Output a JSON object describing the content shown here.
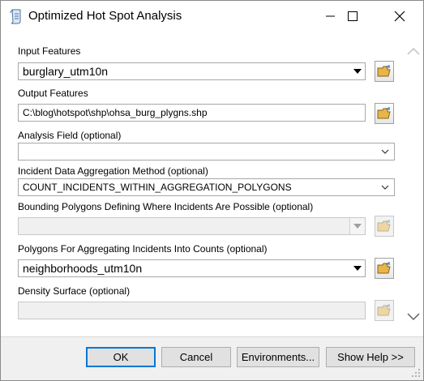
{
  "window": {
    "title": "Optimized Hot Spot Analysis",
    "controls": {
      "minimize_icon": "minimize-icon",
      "maximize_icon": "maximize-icon",
      "close_icon": "close-icon"
    }
  },
  "form": {
    "input_features": {
      "label": "Input Features",
      "value": "burglary_utm10n"
    },
    "output_features": {
      "label": "Output Features",
      "value": "C:\\blog\\hotspot\\shp\\ohsa_burg_plygns.shp"
    },
    "analysis_field": {
      "label": "Analysis Field (optional)",
      "value": ""
    },
    "aggregation_method": {
      "label": "Incident Data Aggregation Method (optional)",
      "value": "COUNT_INCIDENTS_WITHIN_AGGREGATION_POLYGONS"
    },
    "bounding_polygons": {
      "label": "Bounding Polygons Defining Where Incidents Are Possible (optional)",
      "value": ""
    },
    "aggregating_polygons": {
      "label": "Polygons For Aggregating Incidents Into Counts (optional)",
      "value": "neighborhoods_utm10n"
    },
    "density_surface": {
      "label": "Density Surface (optional)",
      "value": ""
    }
  },
  "buttons": {
    "ok": "OK",
    "cancel": "Cancel",
    "environments": "Environments...",
    "show_help": "Show Help >>"
  },
  "colors": {
    "accent": "#0078d7",
    "folder": "#e8b54a"
  }
}
